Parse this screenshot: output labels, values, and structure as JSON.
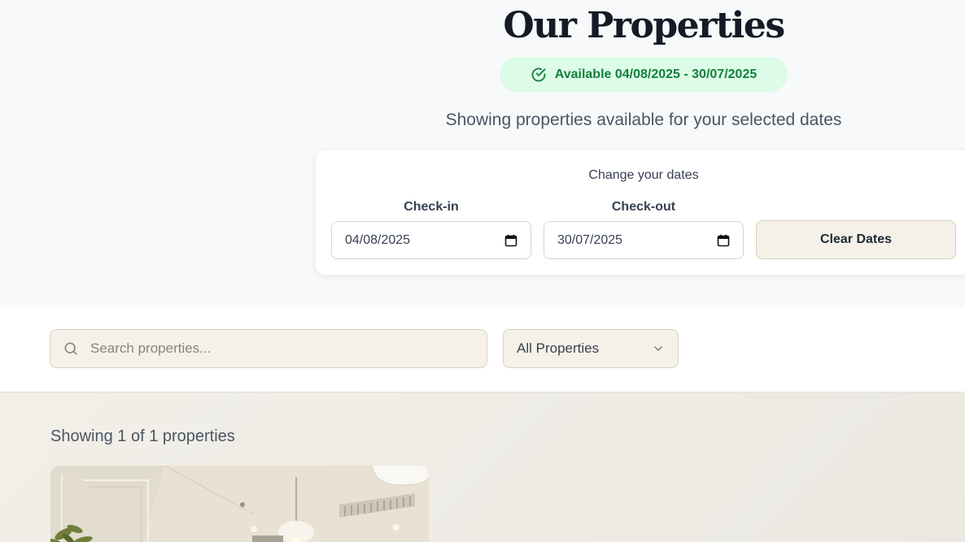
{
  "header": {
    "title": "Our Properties",
    "availability": "Available 04/08/2025 - 30/07/2025",
    "subtitle": "Showing properties available for your selected dates"
  },
  "date_card": {
    "title": "Change your dates",
    "checkin_label": "Check-in",
    "checkin_value": "04/08/2025",
    "checkout_label": "Check-out",
    "checkout_value": "30/07/2025",
    "clear_label": "Clear Dates"
  },
  "filters": {
    "search_placeholder": "Search properties...",
    "type_selected": "All Properties"
  },
  "results": {
    "count_text": "Showing 1 of 1 properties"
  },
  "colors": {
    "accent_green": "#15803d",
    "pill_bg": "#dcfce7",
    "sand": "#f5f1e8"
  }
}
